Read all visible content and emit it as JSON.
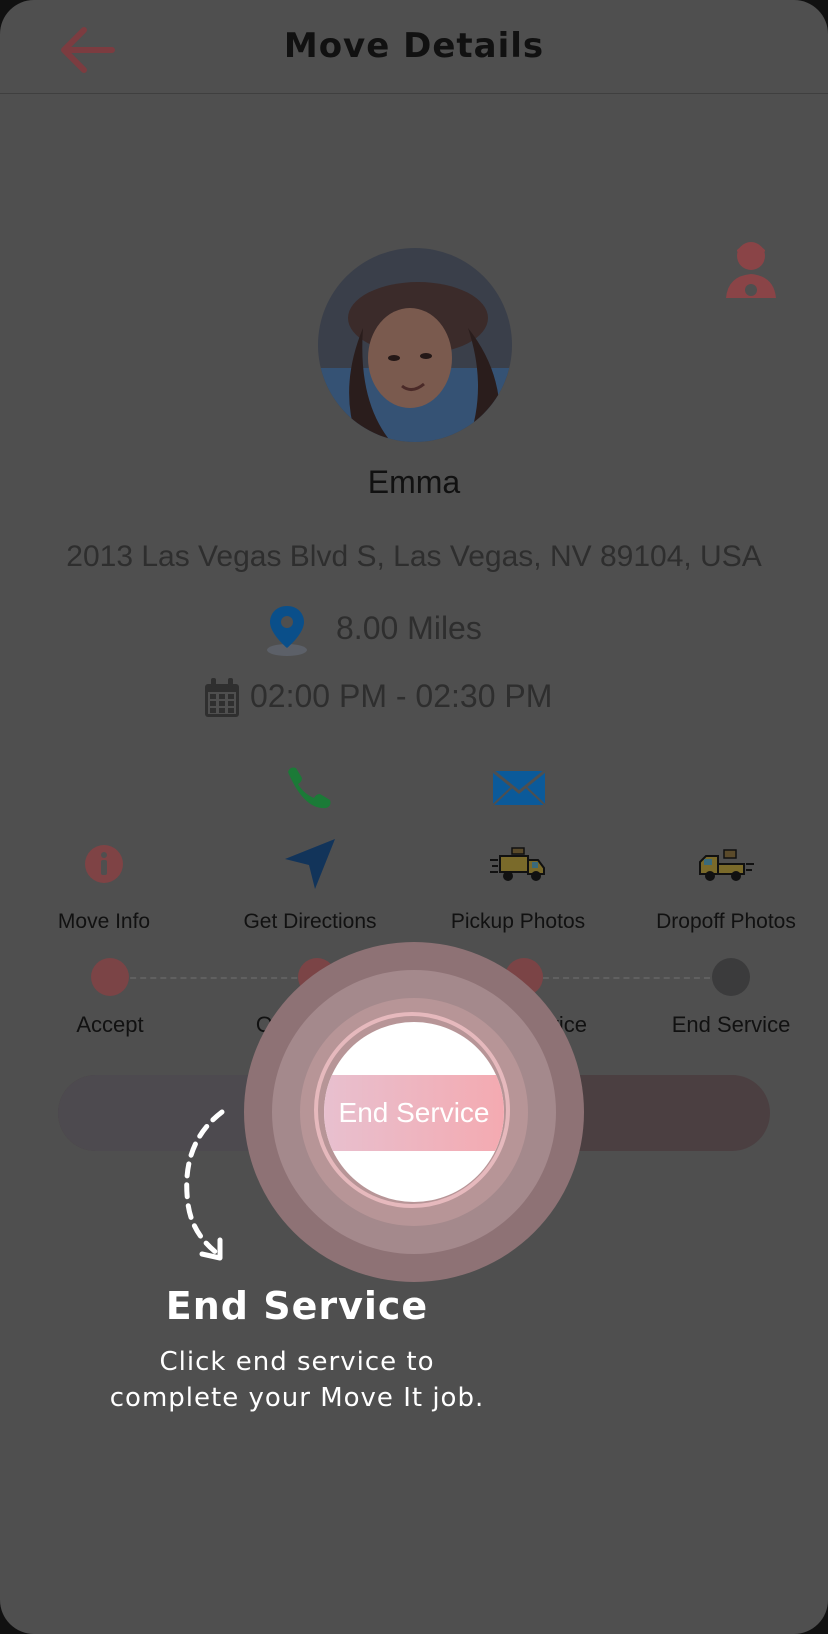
{
  "header": {
    "title": "Move Details",
    "back_icon": "arrow-left-icon"
  },
  "colors": {
    "accent": "#8a3f43",
    "overlay": "#4f4f4f",
    "highlight": "#f4aab1",
    "call_green": "#1b7a37",
    "mail_blue": "#0b5a9a",
    "step_active": "#7b4446",
    "step_pending": "#3b3b3c"
  },
  "customer": {
    "name": "Emma",
    "address": "2013 Las Vegas Blvd S, Las Vegas, NV 89104, USA",
    "distance": "8.00 Miles",
    "time_window": "02:00 PM - 02:30 PM"
  },
  "contact": {
    "call_icon": "phone-icon",
    "mail_icon": "envelope-icon"
  },
  "actions": [
    {
      "label": "Move Info",
      "icon": "info-icon"
    },
    {
      "label": "Get Directions",
      "icon": "navigation-arrow-icon"
    },
    {
      "label": "Pickup Photos",
      "icon": "pickup-truck-icon"
    },
    {
      "label": "Dropoff Photos",
      "icon": "dropoff-truck-icon"
    }
  ],
  "steps": [
    {
      "label": "Accept",
      "done": true
    },
    {
      "label": "On The Way",
      "done": true
    },
    {
      "label": "Start Service",
      "done": true
    },
    {
      "label": "End Service",
      "done": false
    }
  ],
  "primary_button": {
    "label": "End Service"
  },
  "tooltip": {
    "title": "End Service",
    "line1": "Click end service to",
    "line2": "complete your Move It job."
  }
}
